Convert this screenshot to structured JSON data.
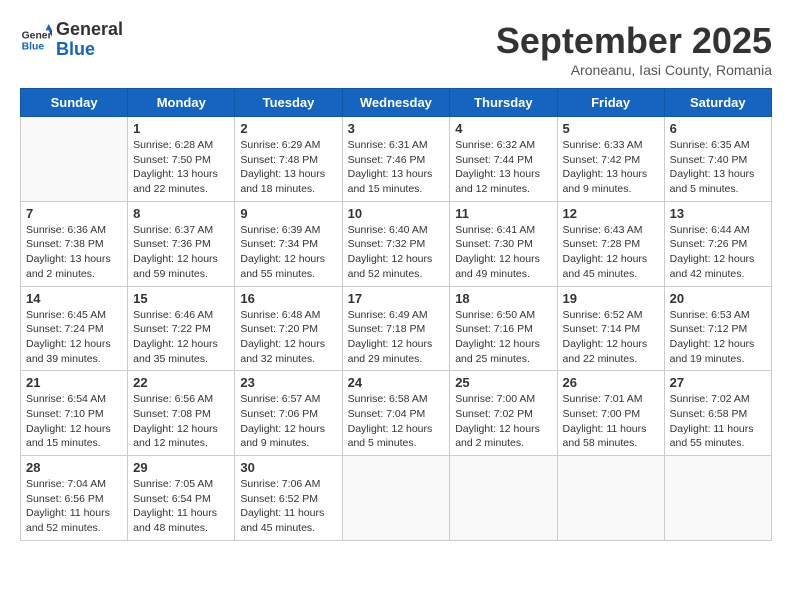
{
  "header": {
    "logo_general": "General",
    "logo_blue": "Blue",
    "month_title": "September 2025",
    "subtitle": "Aroneanu, Iasi County, Romania"
  },
  "weekdays": [
    "Sunday",
    "Monday",
    "Tuesday",
    "Wednesday",
    "Thursday",
    "Friday",
    "Saturday"
  ],
  "weeks": [
    [
      {
        "day": "",
        "info": ""
      },
      {
        "day": "1",
        "info": "Sunrise: 6:28 AM\nSunset: 7:50 PM\nDaylight: 13 hours and 22 minutes."
      },
      {
        "day": "2",
        "info": "Sunrise: 6:29 AM\nSunset: 7:48 PM\nDaylight: 13 hours and 18 minutes."
      },
      {
        "day": "3",
        "info": "Sunrise: 6:31 AM\nSunset: 7:46 PM\nDaylight: 13 hours and 15 minutes."
      },
      {
        "day": "4",
        "info": "Sunrise: 6:32 AM\nSunset: 7:44 PM\nDaylight: 13 hours and 12 minutes."
      },
      {
        "day": "5",
        "info": "Sunrise: 6:33 AM\nSunset: 7:42 PM\nDaylight: 13 hours and 9 minutes."
      },
      {
        "day": "6",
        "info": "Sunrise: 6:35 AM\nSunset: 7:40 PM\nDaylight: 13 hours and 5 minutes."
      }
    ],
    [
      {
        "day": "7",
        "info": "Sunrise: 6:36 AM\nSunset: 7:38 PM\nDaylight: 13 hours and 2 minutes."
      },
      {
        "day": "8",
        "info": "Sunrise: 6:37 AM\nSunset: 7:36 PM\nDaylight: 12 hours and 59 minutes."
      },
      {
        "day": "9",
        "info": "Sunrise: 6:39 AM\nSunset: 7:34 PM\nDaylight: 12 hours and 55 minutes."
      },
      {
        "day": "10",
        "info": "Sunrise: 6:40 AM\nSunset: 7:32 PM\nDaylight: 12 hours and 52 minutes."
      },
      {
        "day": "11",
        "info": "Sunrise: 6:41 AM\nSunset: 7:30 PM\nDaylight: 12 hours and 49 minutes."
      },
      {
        "day": "12",
        "info": "Sunrise: 6:43 AM\nSunset: 7:28 PM\nDaylight: 12 hours and 45 minutes."
      },
      {
        "day": "13",
        "info": "Sunrise: 6:44 AM\nSunset: 7:26 PM\nDaylight: 12 hours and 42 minutes."
      }
    ],
    [
      {
        "day": "14",
        "info": "Sunrise: 6:45 AM\nSunset: 7:24 PM\nDaylight: 12 hours and 39 minutes."
      },
      {
        "day": "15",
        "info": "Sunrise: 6:46 AM\nSunset: 7:22 PM\nDaylight: 12 hours and 35 minutes."
      },
      {
        "day": "16",
        "info": "Sunrise: 6:48 AM\nSunset: 7:20 PM\nDaylight: 12 hours and 32 minutes."
      },
      {
        "day": "17",
        "info": "Sunrise: 6:49 AM\nSunset: 7:18 PM\nDaylight: 12 hours and 29 minutes."
      },
      {
        "day": "18",
        "info": "Sunrise: 6:50 AM\nSunset: 7:16 PM\nDaylight: 12 hours and 25 minutes."
      },
      {
        "day": "19",
        "info": "Sunrise: 6:52 AM\nSunset: 7:14 PM\nDaylight: 12 hours and 22 minutes."
      },
      {
        "day": "20",
        "info": "Sunrise: 6:53 AM\nSunset: 7:12 PM\nDaylight: 12 hours and 19 minutes."
      }
    ],
    [
      {
        "day": "21",
        "info": "Sunrise: 6:54 AM\nSunset: 7:10 PM\nDaylight: 12 hours and 15 minutes."
      },
      {
        "day": "22",
        "info": "Sunrise: 6:56 AM\nSunset: 7:08 PM\nDaylight: 12 hours and 12 minutes."
      },
      {
        "day": "23",
        "info": "Sunrise: 6:57 AM\nSunset: 7:06 PM\nDaylight: 12 hours and 9 minutes."
      },
      {
        "day": "24",
        "info": "Sunrise: 6:58 AM\nSunset: 7:04 PM\nDaylight: 12 hours and 5 minutes."
      },
      {
        "day": "25",
        "info": "Sunrise: 7:00 AM\nSunset: 7:02 PM\nDaylight: 12 hours and 2 minutes."
      },
      {
        "day": "26",
        "info": "Sunrise: 7:01 AM\nSunset: 7:00 PM\nDaylight: 11 hours and 58 minutes."
      },
      {
        "day": "27",
        "info": "Sunrise: 7:02 AM\nSunset: 6:58 PM\nDaylight: 11 hours and 55 minutes."
      }
    ],
    [
      {
        "day": "28",
        "info": "Sunrise: 7:04 AM\nSunset: 6:56 PM\nDaylight: 11 hours and 52 minutes."
      },
      {
        "day": "29",
        "info": "Sunrise: 7:05 AM\nSunset: 6:54 PM\nDaylight: 11 hours and 48 minutes."
      },
      {
        "day": "30",
        "info": "Sunrise: 7:06 AM\nSunset: 6:52 PM\nDaylight: 11 hours and 45 minutes."
      },
      {
        "day": "",
        "info": ""
      },
      {
        "day": "",
        "info": ""
      },
      {
        "day": "",
        "info": ""
      },
      {
        "day": "",
        "info": ""
      }
    ]
  ]
}
